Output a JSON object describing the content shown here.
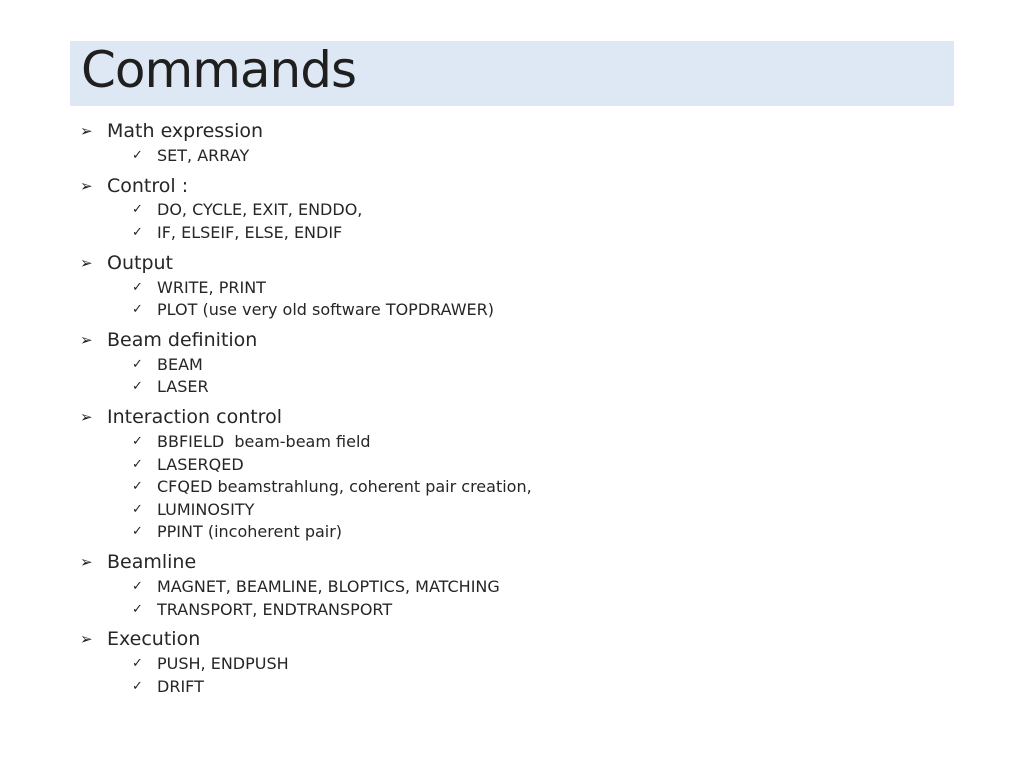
{
  "title": "Commands",
  "bullets": {
    "level1": "arrow-bullet-icon",
    "level2": "check-bullet-icon"
  },
  "colors": {
    "title_background": "#dde8f4",
    "text": "#262626"
  },
  "sections": [
    {
      "label": "Math expression",
      "items": [
        "SET, ARRAY"
      ]
    },
    {
      "label": "Control :",
      "items": [
        "DO, CYCLE, EXIT, ENDDO,",
        "IF, ELSEIF, ELSE, ENDIF"
      ]
    },
    {
      "label": "Output",
      "items": [
        "WRITE, PRINT",
        "PLOT (use very old software TOPDRAWER)"
      ]
    },
    {
      "label": "Beam definition",
      "items": [
        "BEAM",
        "LASER"
      ]
    },
    {
      "label": "Interaction control",
      "items": [
        "BBFIELD  beam-beam field",
        "LASERQED",
        "CFQED beamstrahlung, coherent pair creation,",
        "LUMINOSITY",
        "PPINT (incoherent pair)"
      ]
    },
    {
      "label": "Beamline",
      "items": [
        "MAGNET, BEAMLINE, BLOPTICS, MATCHING",
        "TRANSPORT, ENDTRANSPORT"
      ]
    },
    {
      "label": "Execution",
      "items": [
        "PUSH, ENDPUSH",
        "DRIFT"
      ]
    }
  ]
}
